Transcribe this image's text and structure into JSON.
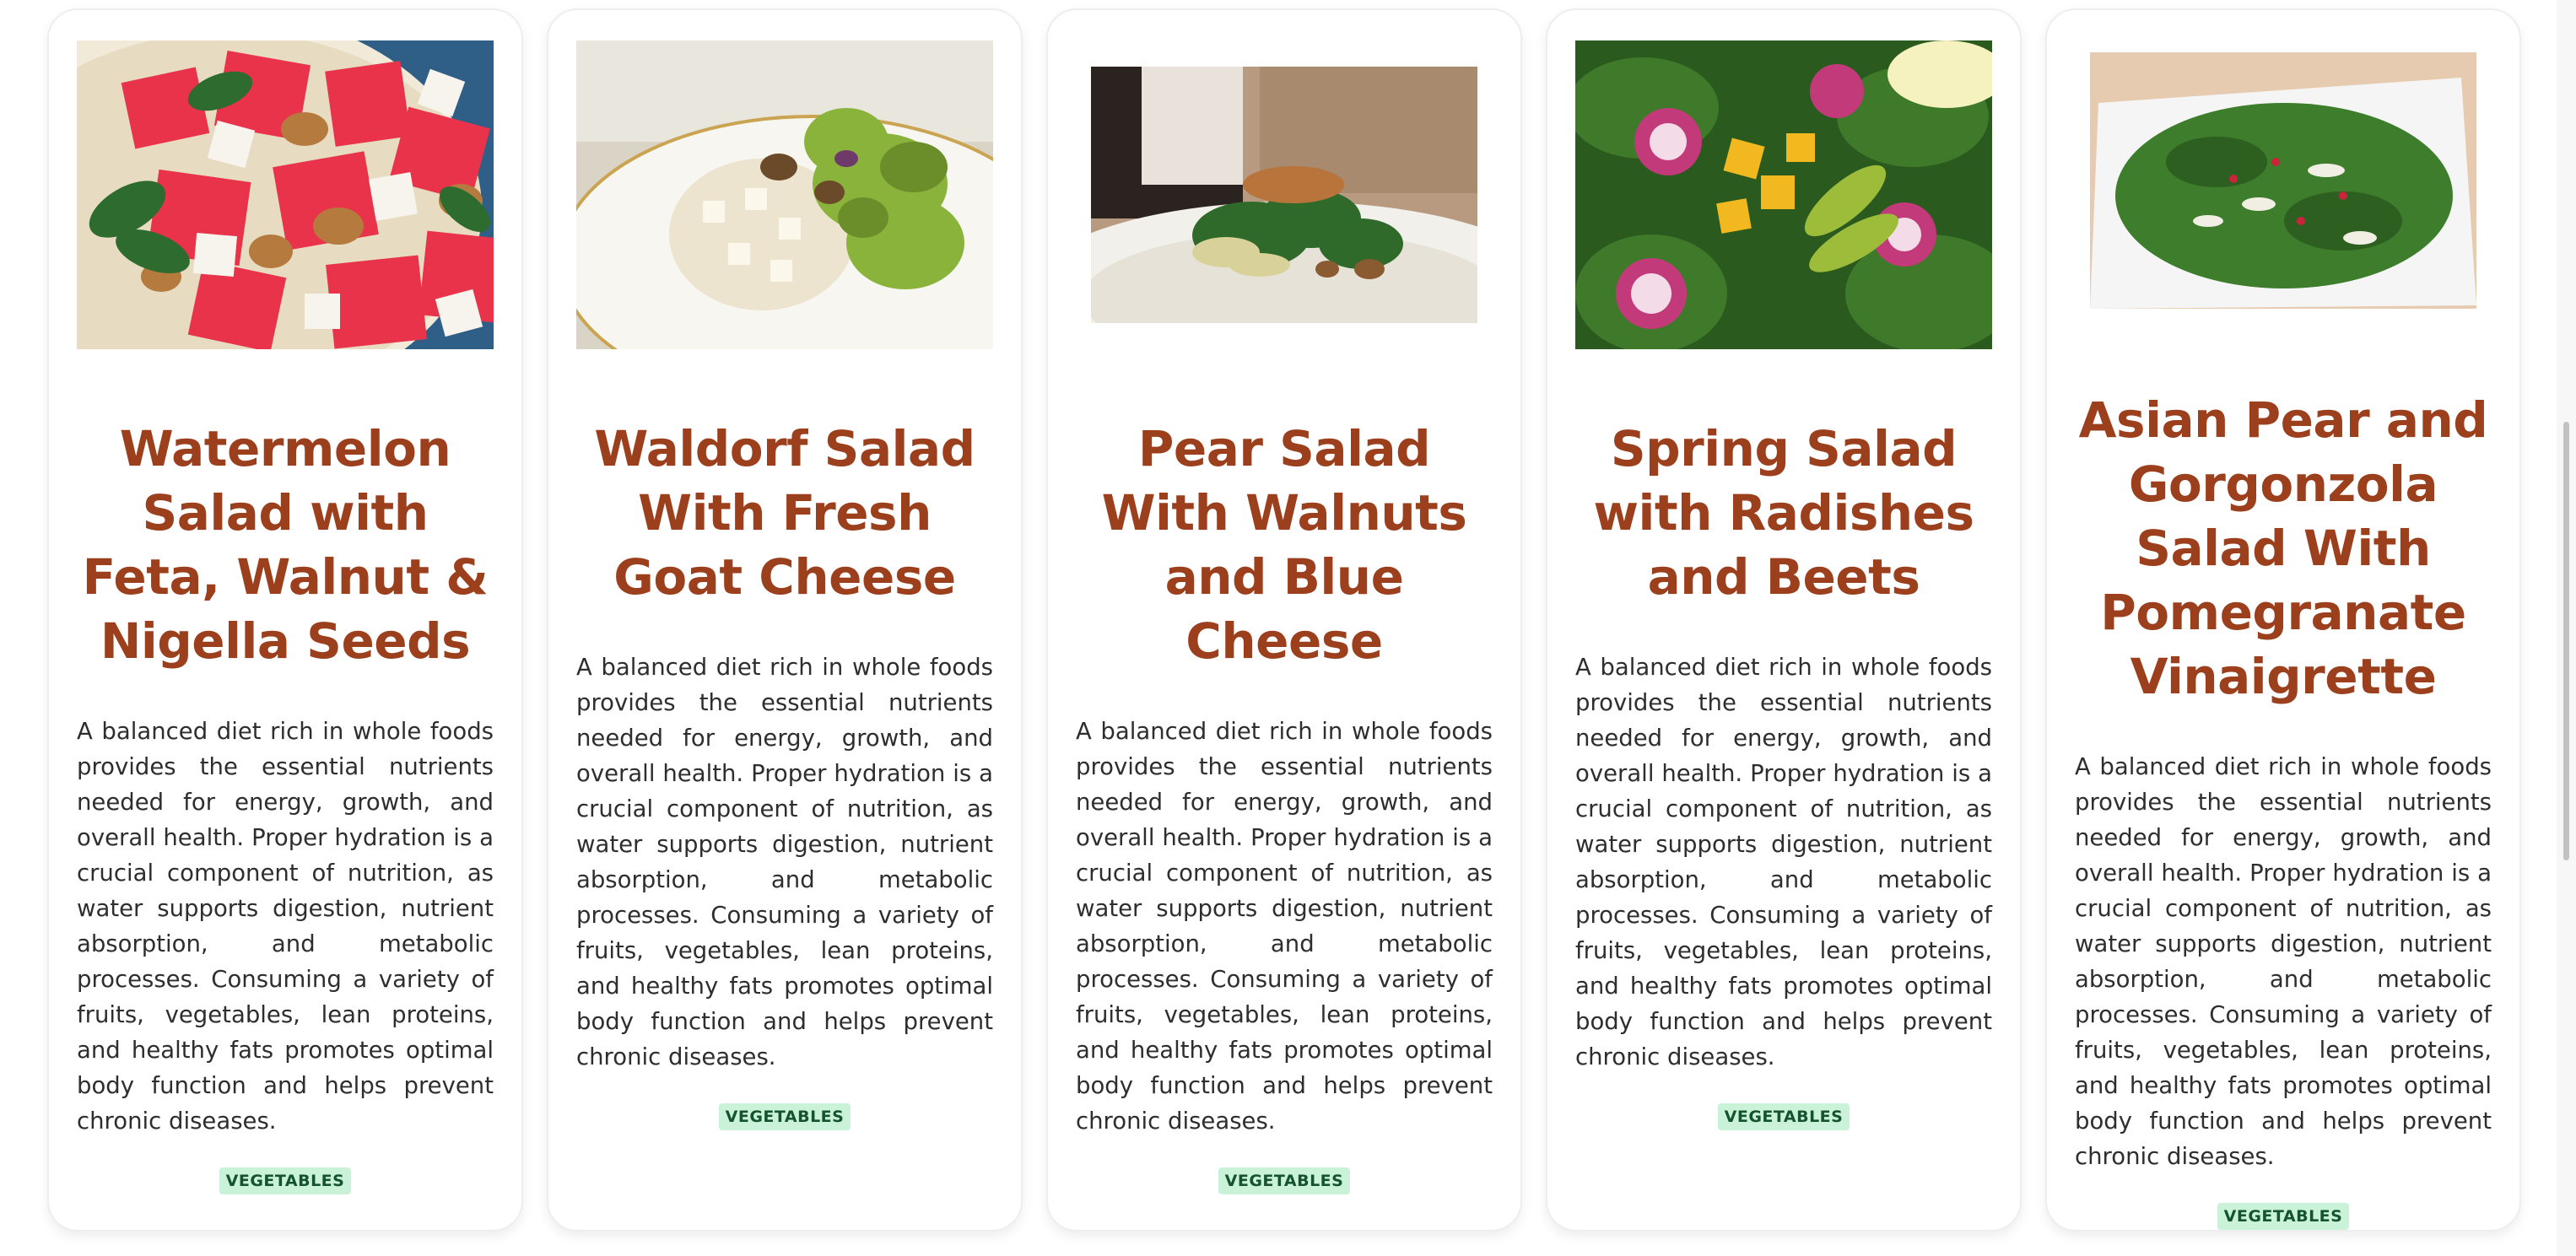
{
  "cards": [
    {
      "title": "Watermelon Salad with Feta, Walnut & Nigella Seeds",
      "image_alt": "Watermelon salad with feta cubes, walnuts and mint",
      "description": "A balanced diet rich in whole foods provides the essential nutrients needed for energy, growth, and overall health. Proper hydration is a crucial component of nutrition, as water supports digestion, nutrient absorption, and metabolic processes. Consuming a variety of fruits, vegetables, lean proteins, and healthy fats promotes optimal body function and helps prevent chronic diseases.",
      "tag": "VEGETABLES"
    },
    {
      "title": "Waldorf Salad With Fresh Goat Cheese",
      "image_alt": "Waldorf salad on a white plate",
      "description": "A balanced diet rich in whole foods provides the essential nutrients needed for energy, growth, and overall health. Proper hydration is a crucial component of nutrition, as water supports digestion, nutrient absorption, and metabolic processes. Consuming a variety of fruits, vegetables, lean proteins, and healthy fats promotes optimal body function and helps prevent chronic diseases.",
      "tag": "VEGETABLES"
    },
    {
      "title": "Pear Salad With Walnuts and Blue Cheese",
      "image_alt": "Pear salad with walnuts and blue cheese on a plate",
      "description": "A balanced diet rich in whole foods provides the essential nutrients needed for energy, growth, and overall health. Proper hydration is a crucial component of nutrition, as water supports digestion, nutrient absorption, and metabolic processes. Consuming a variety of fruits, vegetables, lean proteins, and healthy fats promotes optimal body function and helps prevent chronic diseases.",
      "tag": "VEGETABLES"
    },
    {
      "title": "Spring Salad with Radishes and Beets",
      "image_alt": "Spring salad with radishes, beets and avocado",
      "description": "A balanced diet rich in whole foods provides the essential nutrients needed for energy, growth, and overall health. Proper hydration is a crucial component of nutrition, as water supports digestion, nutrient absorption, and metabolic processes. Consuming a variety of fruits, vegetables, lean proteins, and healthy fats promotes optimal body function and helps prevent chronic diseases.",
      "tag": "VEGETABLES"
    },
    {
      "title": "Asian Pear and Gorgonzola Salad With Pomegranate Vinaigrette",
      "image_alt": "Arugula salad with pear and pomegranate on a square plate",
      "description": "A balanced diet rich in whole foods provides the essential nutrients needed for energy, growth, and overall health. Proper hydration is a crucial component of nutrition, as water supports digestion, nutrient absorption, and metabolic processes. Consuming a variety of fruits, vegetables, lean proteins, and healthy fats promotes optimal body function and helps prevent chronic diseases.",
      "tag": "VEGETABLES"
    }
  ],
  "colors": {
    "title": "#9b3f1d",
    "tag_bg": "#c9f2d9",
    "tag_text": "#14532d",
    "body_text": "#2e2e2e"
  }
}
